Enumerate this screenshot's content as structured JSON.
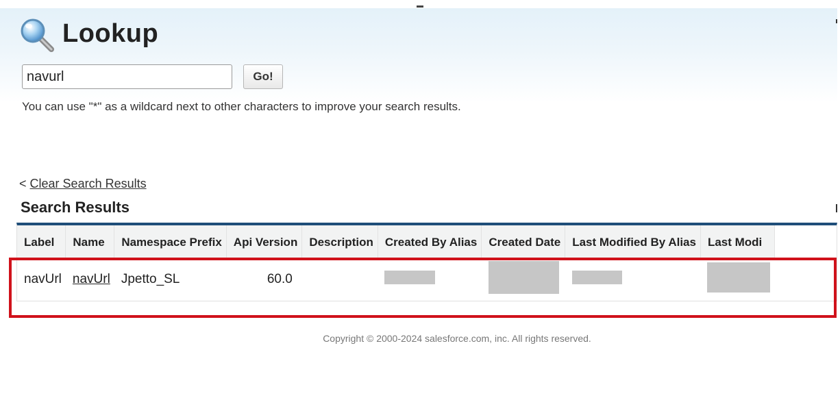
{
  "page": {
    "title": "Lookup"
  },
  "search": {
    "value": "navurl",
    "go_label": "Go!",
    "hint": "You can use \"*\" as a wildcard next to other characters to improve your search results."
  },
  "results": {
    "clear_prefix": "<",
    "clear_label": "Clear Search Results",
    "title": "Search Results",
    "columns": [
      "Label",
      "Name",
      "Namespace Prefix",
      "Api Version",
      "Description",
      "Created By Alias",
      "Created Date",
      "Last Modified By Alias",
      "Last Modi"
    ],
    "rows": [
      {
        "label": "navUrl",
        "name": "navUrl",
        "namespace_prefix": "Jpetto_SL",
        "api_version": "60.0",
        "description": ""
      }
    ]
  },
  "footer": {
    "copyright": "Copyright © 2000-2024 salesforce.com, inc. All rights reserved."
  },
  "colors": {
    "accent_border": "#1f4e79",
    "highlight": "#d0121b",
    "header_gradient": "#e4f1f9",
    "redaction": "#c6c6c6"
  },
  "icons": {
    "lookup": "magnifying-glass-icon"
  }
}
